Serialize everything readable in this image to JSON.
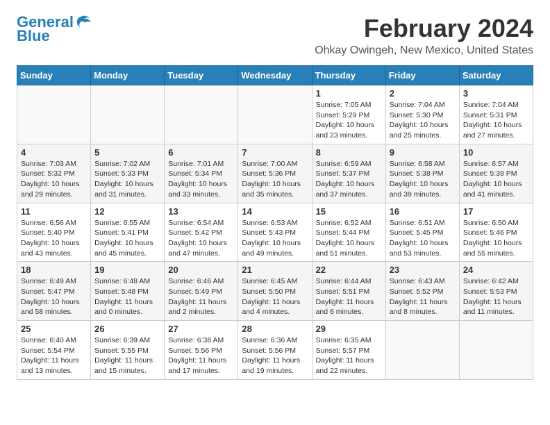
{
  "header": {
    "logo_line1": "General",
    "logo_line2": "Blue",
    "title": "February 2024",
    "subtitle": "Ohkay Owingeh, New Mexico, United States"
  },
  "calendar": {
    "days_of_week": [
      "Sunday",
      "Monday",
      "Tuesday",
      "Wednesday",
      "Thursday",
      "Friday",
      "Saturday"
    ],
    "weeks": [
      [
        {
          "day": "",
          "info": ""
        },
        {
          "day": "",
          "info": ""
        },
        {
          "day": "",
          "info": ""
        },
        {
          "day": "",
          "info": ""
        },
        {
          "day": "1",
          "info": "Sunrise: 7:05 AM\nSunset: 5:29 PM\nDaylight: 10 hours\nand 23 minutes."
        },
        {
          "day": "2",
          "info": "Sunrise: 7:04 AM\nSunset: 5:30 PM\nDaylight: 10 hours\nand 25 minutes."
        },
        {
          "day": "3",
          "info": "Sunrise: 7:04 AM\nSunset: 5:31 PM\nDaylight: 10 hours\nand 27 minutes."
        }
      ],
      [
        {
          "day": "4",
          "info": "Sunrise: 7:03 AM\nSunset: 5:32 PM\nDaylight: 10 hours\nand 29 minutes."
        },
        {
          "day": "5",
          "info": "Sunrise: 7:02 AM\nSunset: 5:33 PM\nDaylight: 10 hours\nand 31 minutes."
        },
        {
          "day": "6",
          "info": "Sunrise: 7:01 AM\nSunset: 5:34 PM\nDaylight: 10 hours\nand 33 minutes."
        },
        {
          "day": "7",
          "info": "Sunrise: 7:00 AM\nSunset: 5:36 PM\nDaylight: 10 hours\nand 35 minutes."
        },
        {
          "day": "8",
          "info": "Sunrise: 6:59 AM\nSunset: 5:37 PM\nDaylight: 10 hours\nand 37 minutes."
        },
        {
          "day": "9",
          "info": "Sunrise: 6:58 AM\nSunset: 5:38 PM\nDaylight: 10 hours\nand 39 minutes."
        },
        {
          "day": "10",
          "info": "Sunrise: 6:57 AM\nSunset: 5:39 PM\nDaylight: 10 hours\nand 41 minutes."
        }
      ],
      [
        {
          "day": "11",
          "info": "Sunrise: 6:56 AM\nSunset: 5:40 PM\nDaylight: 10 hours\nand 43 minutes."
        },
        {
          "day": "12",
          "info": "Sunrise: 6:55 AM\nSunset: 5:41 PM\nDaylight: 10 hours\nand 45 minutes."
        },
        {
          "day": "13",
          "info": "Sunrise: 6:54 AM\nSunset: 5:42 PM\nDaylight: 10 hours\nand 47 minutes."
        },
        {
          "day": "14",
          "info": "Sunrise: 6:53 AM\nSunset: 5:43 PM\nDaylight: 10 hours\nand 49 minutes."
        },
        {
          "day": "15",
          "info": "Sunrise: 6:52 AM\nSunset: 5:44 PM\nDaylight: 10 hours\nand 51 minutes."
        },
        {
          "day": "16",
          "info": "Sunrise: 6:51 AM\nSunset: 5:45 PM\nDaylight: 10 hours\nand 53 minutes."
        },
        {
          "day": "17",
          "info": "Sunrise: 6:50 AM\nSunset: 5:46 PM\nDaylight: 10 hours\nand 55 minutes."
        }
      ],
      [
        {
          "day": "18",
          "info": "Sunrise: 6:49 AM\nSunset: 5:47 PM\nDaylight: 10 hours\nand 58 minutes."
        },
        {
          "day": "19",
          "info": "Sunrise: 6:48 AM\nSunset: 5:48 PM\nDaylight: 11 hours\nand 0 minutes."
        },
        {
          "day": "20",
          "info": "Sunrise: 6:46 AM\nSunset: 5:49 PM\nDaylight: 11 hours\nand 2 minutes."
        },
        {
          "day": "21",
          "info": "Sunrise: 6:45 AM\nSunset: 5:50 PM\nDaylight: 11 hours\nand 4 minutes."
        },
        {
          "day": "22",
          "info": "Sunrise: 6:44 AM\nSunset: 5:51 PM\nDaylight: 11 hours\nand 6 minutes."
        },
        {
          "day": "23",
          "info": "Sunrise: 6:43 AM\nSunset: 5:52 PM\nDaylight: 11 hours\nand 8 minutes."
        },
        {
          "day": "24",
          "info": "Sunrise: 6:42 AM\nSunset: 5:53 PM\nDaylight: 11 hours\nand 11 minutes."
        }
      ],
      [
        {
          "day": "25",
          "info": "Sunrise: 6:40 AM\nSunset: 5:54 PM\nDaylight: 11 hours\nand 13 minutes."
        },
        {
          "day": "26",
          "info": "Sunrise: 6:39 AM\nSunset: 5:55 PM\nDaylight: 11 hours\nand 15 minutes."
        },
        {
          "day": "27",
          "info": "Sunrise: 6:38 AM\nSunset: 5:56 PM\nDaylight: 11 hours\nand 17 minutes."
        },
        {
          "day": "28",
          "info": "Sunrise: 6:36 AM\nSunset: 5:56 PM\nDaylight: 11 hours\nand 19 minutes."
        },
        {
          "day": "29",
          "info": "Sunrise: 6:35 AM\nSunset: 5:57 PM\nDaylight: 11 hours\nand 22 minutes."
        },
        {
          "day": "",
          "info": ""
        },
        {
          "day": "",
          "info": ""
        }
      ]
    ]
  }
}
